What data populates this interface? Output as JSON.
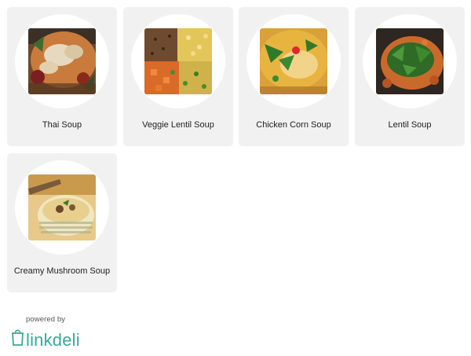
{
  "items": [
    {
      "label": "Thai Soup",
      "image": "thai-soup-photo"
    },
    {
      "label": "Veggie Lentil Soup",
      "image": "veggie-lentil-soup-photo"
    },
    {
      "label": "Chicken Corn Soup",
      "image": "chicken-corn-soup-photo"
    },
    {
      "label": "Lentil Soup",
      "image": "lentil-soup-photo"
    },
    {
      "label": "Creamy Mushroom Soup",
      "image": "creamy-mushroom-soup-photo"
    }
  ],
  "footer": {
    "powered_by": "powered by",
    "brand_name": "linkdeli",
    "brand_logo_text": "linkdeli",
    "brand_color": "#3aa89a"
  }
}
